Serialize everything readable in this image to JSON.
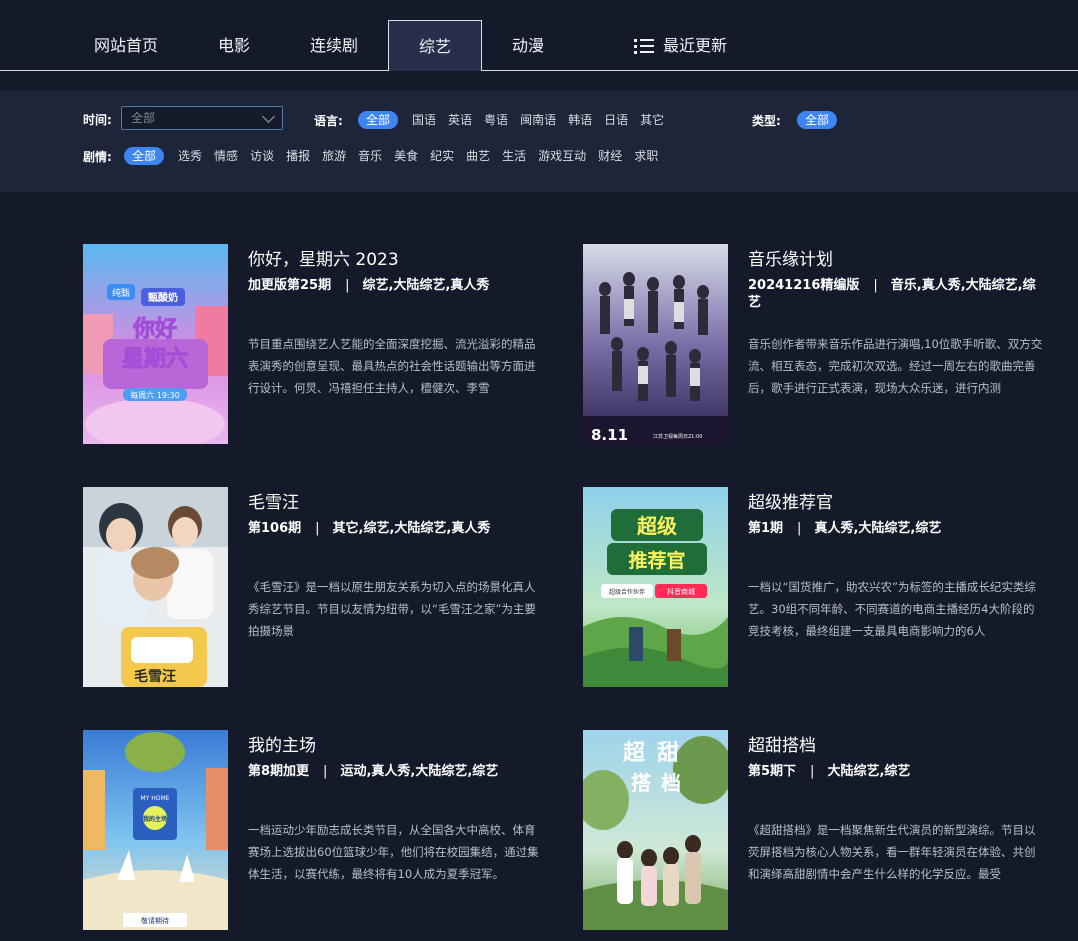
{
  "nav": {
    "items": [
      "网站首页",
      "电影",
      "连续剧",
      "综艺",
      "动漫"
    ],
    "active_index": 3,
    "recent_label": "最近更新"
  },
  "filters": {
    "time_label": "时间:",
    "time_select_value": "全部",
    "language_label": "语言:",
    "language_options": [
      "全部",
      "国语",
      "英语",
      "粤语",
      "闽南语",
      "韩语",
      "日语",
      "其它"
    ],
    "type_label": "类型:",
    "type_options": [
      "全部"
    ],
    "plot_label": "剧情:",
    "plot_options": [
      "全部",
      "选秀",
      "情感",
      "访谈",
      "播报",
      "旅游",
      "音乐",
      "美食",
      "纪实",
      "曲艺",
      "生活",
      "游戏互动",
      "财经",
      "求职"
    ]
  },
  "cards": [
    {
      "title": "你好，星期六 2023",
      "episode": "加更版第25期",
      "tags": "综艺,大陆综艺,真人秀",
      "desc": "节目重点围绕艺人艺能的全面深度挖掘、流光溢彩的精品表演秀的创意呈现、最具热点的社会性话题输出等方面进行设计。何炅、冯禧担任主持人，檀健次、李雪",
      "poster_text": [
        "纯甄",
        "甄酸奶",
        "你好",
        "星期六",
        "每周六 19:30"
      ]
    },
    {
      "title": "音乐缘计划",
      "episode": "20241216精编版",
      "tags": "音乐,真人秀,大陆综艺,综艺",
      "desc": "音乐创作者带来音乐作品进行演唱,10位歌手听歌、双方交流、相互表态，完成初次双选。经过一周左右的歌曲完善后，歌手进行正式表演，现场大众乐迷，进行内测",
      "poster_text": [
        "8.11",
        "江苏卫视每周日21:00"
      ]
    },
    {
      "title": "毛雪汪",
      "episode": "第106期",
      "tags": "其它,综艺,大陆综艺,真人秀",
      "desc": "《毛雪汪》是一档以原生朋友关系为切入点的场景化真人秀综艺节目。节目以友情为纽带，以“毛雪汪之家”为主要拍摄场景",
      "poster_text": [
        "毛雪汪"
      ]
    },
    {
      "title": "超级推荐官",
      "episode": "第1期",
      "tags": "真人秀,大陆综艺,综艺",
      "desc": "一档以“国货推广，助农兴农”为标签的主播成长纪实类综艺。30组不同年龄、不同赛道的电商主播经历4大阶段的竞技考核，最终组建一支最具电商影响力的6人",
      "poster_text": [
        "超级",
        "推荐官",
        "超级合作伙伴",
        "抖音商城"
      ]
    },
    {
      "title": "我的主场",
      "episode": "第8期加更",
      "tags": "运动,真人秀,大陆综艺,综艺",
      "desc": "一档运动少年励志成长类节目，从全国各大中高校、体育赛场上选拔出60位篮球少年，他们将在校园集结，通过集体生活，以赛代练，最终将有10人成为夏季冠军。",
      "poster_text": [
        "MY HOME",
        "我的主场",
        "敬请期待"
      ]
    },
    {
      "title": "超甜搭档",
      "episode": "第5期下",
      "tags": "大陆综艺,综艺",
      "desc": "《超甜搭档》是一档聚焦新生代演员的新型演综。节目以荧屏搭档为核心人物关系，看一群年轻演员在体验、共创和演绎高甜剧情中会产生什么样的化学反应。最受",
      "poster_text": [
        "超",
        "甜",
        "搭",
        "档"
      ]
    }
  ]
}
